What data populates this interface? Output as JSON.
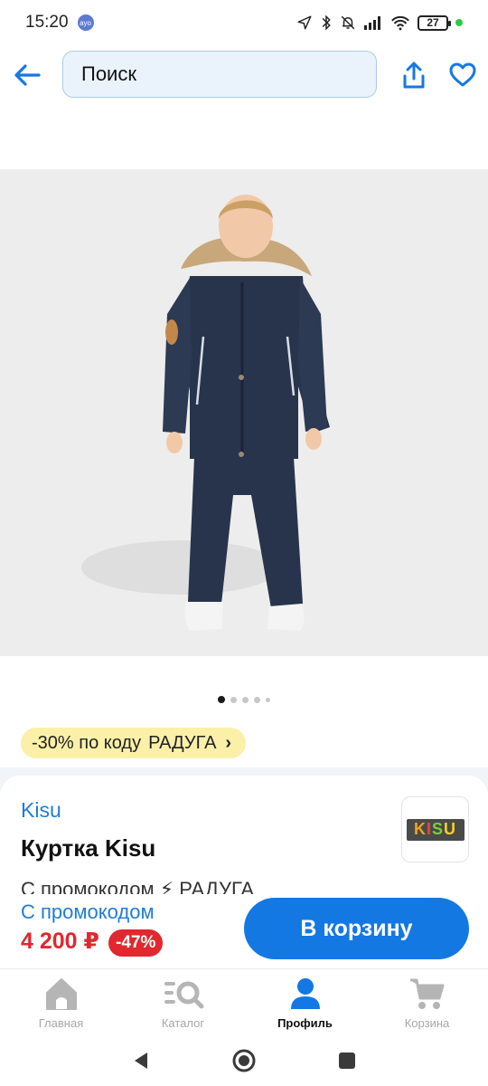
{
  "status_bar": {
    "time": "15:20",
    "badge": "ayo",
    "battery": "27"
  },
  "search": {
    "value": "Поиск"
  },
  "gallery": {
    "dots_count": 5,
    "active_index": 0
  },
  "promo": {
    "text": "-30% по коду",
    "code": "РАДУГА",
    "chevron": "›"
  },
  "product": {
    "brand": "Kisu",
    "title": "Куртка Kisu",
    "logo_text": "KISU",
    "partial_line": "С промокодом  ⚡ РАДУГА"
  },
  "buy_bar": {
    "promo_label": "С промокодом",
    "price": "4 200 ₽",
    "discount": "-47%",
    "cart_button": "В корзину"
  },
  "bottom_nav": {
    "items": [
      {
        "label": "Главная",
        "icon": "home-icon",
        "active": false
      },
      {
        "label": "Каталог",
        "icon": "catalog-search-icon",
        "active": false
      },
      {
        "label": "Профиль",
        "icon": "profile-icon",
        "active": true
      },
      {
        "label": "Корзина",
        "icon": "cart-icon",
        "active": false
      }
    ]
  },
  "colors": {
    "accent": "#1478e3",
    "price_red": "#e0282e",
    "promo_yellow": "#fbf0a8",
    "link_blue": "#1e7dd6"
  }
}
